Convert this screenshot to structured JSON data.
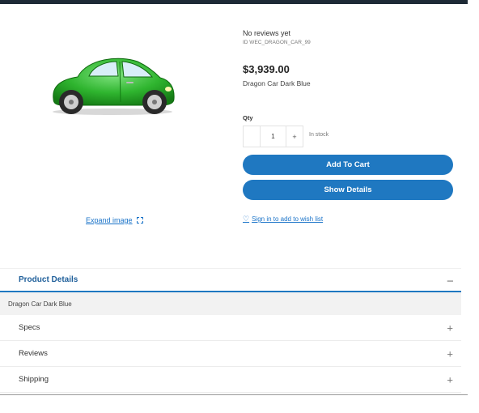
{
  "product": {
    "reviews": "No reviews yet",
    "sku": "ID WEC_DRAGON_CAR_99",
    "price": "$3,939.00",
    "name": "Dragon Car Dark Blue",
    "image_alt": "green-car"
  },
  "image_panel": {
    "expand_label": "Expand image"
  },
  "quantity": {
    "label": "Qty",
    "value": "1",
    "minus": "",
    "plus": "+",
    "stock": "In stock"
  },
  "actions": {
    "add_to_cart": "Add To Cart",
    "show_details": "Show Details",
    "wishlist": "Sign in to add to wish list"
  },
  "details": {
    "open_section": {
      "title": "Product Details",
      "toggle": "–",
      "body": "Dragon Car Dark Blue"
    },
    "sections": [
      {
        "title": "Specs",
        "toggle": "+"
      },
      {
        "title": "Reviews",
        "toggle": "+"
      },
      {
        "title": "Shipping",
        "toggle": "+"
      }
    ]
  },
  "colors": {
    "accent": "#1f78c1",
    "car_body": "#2fb52f"
  }
}
